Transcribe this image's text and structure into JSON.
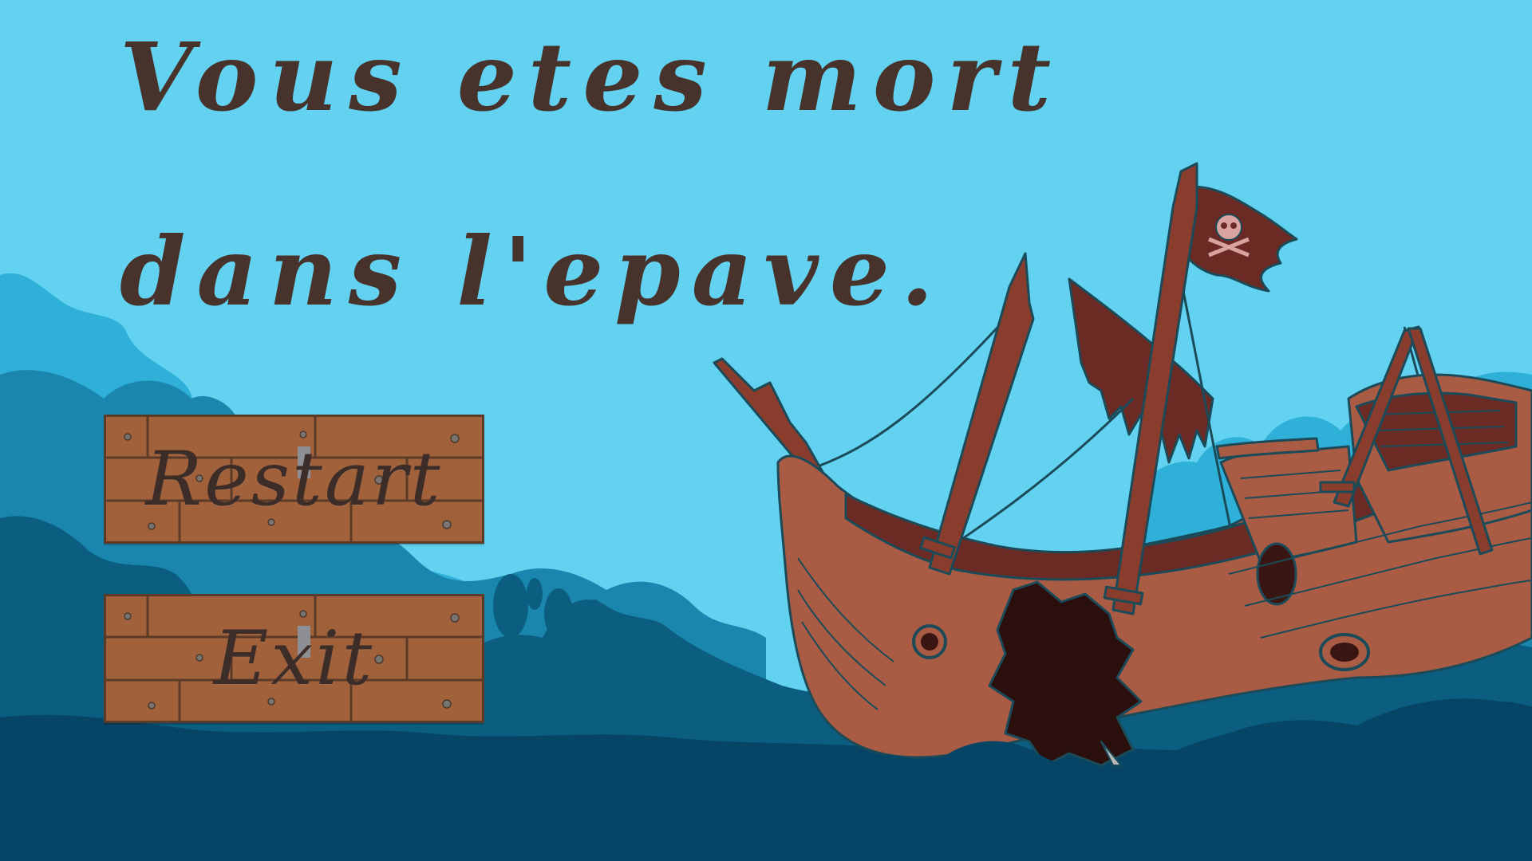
{
  "game_over": {
    "title_line_1": "Vous etes mort",
    "title_line_2": "dans l'epave."
  },
  "menu": {
    "restart_label": "Restart",
    "exit_label": "Exit"
  },
  "colors": {
    "sky": "#62d2f0",
    "reef_light": "#2eb0d9",
    "reef_mid": "#1a86ad",
    "reef_dark": "#0b5e80",
    "seabed": "#064566",
    "title_text": "#47332c",
    "plank": "#a0613b",
    "plank_line": "#5b3a28",
    "ship_hull": "#a95b44",
    "ship_dark": "#6b2a23",
    "ship_outline": "#1b4a59"
  },
  "icons": {
    "flag": "jolly-roger-flag-icon",
    "ship": "sunken-pirate-ship"
  }
}
